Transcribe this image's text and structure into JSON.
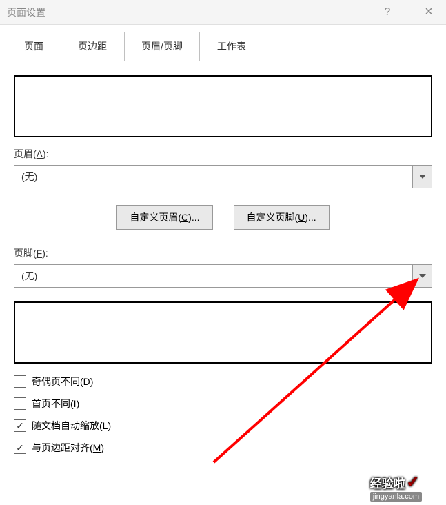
{
  "window": {
    "title": "页面设置",
    "help": "?",
    "close": "×"
  },
  "tabs": {
    "page": "页面",
    "margins": "页边距",
    "header_footer": "页眉/页脚",
    "sheet": "工作表"
  },
  "header": {
    "label_prefix": "页眉(",
    "label_key": "A",
    "label_suffix": "):",
    "value": "(无)"
  },
  "footer": {
    "label_prefix": "页脚(",
    "label_key": "F",
    "label_suffix": "):",
    "value": "(无)"
  },
  "buttons": {
    "custom_header_prefix": "自定义页眉(",
    "custom_header_key": "C",
    "custom_header_suffix": ")...",
    "custom_footer_prefix": "自定义页脚(",
    "custom_footer_key": "U",
    "custom_footer_suffix": ")..."
  },
  "checkboxes": {
    "diff_odd_even_prefix": "奇偶页不同(",
    "diff_odd_even_key": "D",
    "diff_odd_even_suffix": ")",
    "diff_first_prefix": "首页不同(",
    "diff_first_key": "I",
    "diff_first_suffix": ")",
    "scale_doc_prefix": "随文档自动缩放(",
    "scale_doc_key": "L",
    "scale_doc_suffix": ")",
    "align_margins_prefix": "与页边距对齐(",
    "align_margins_key": "M",
    "align_margins_suffix": ")"
  },
  "watermark": {
    "text": "经验啦",
    "url": "jingyanla.com"
  }
}
